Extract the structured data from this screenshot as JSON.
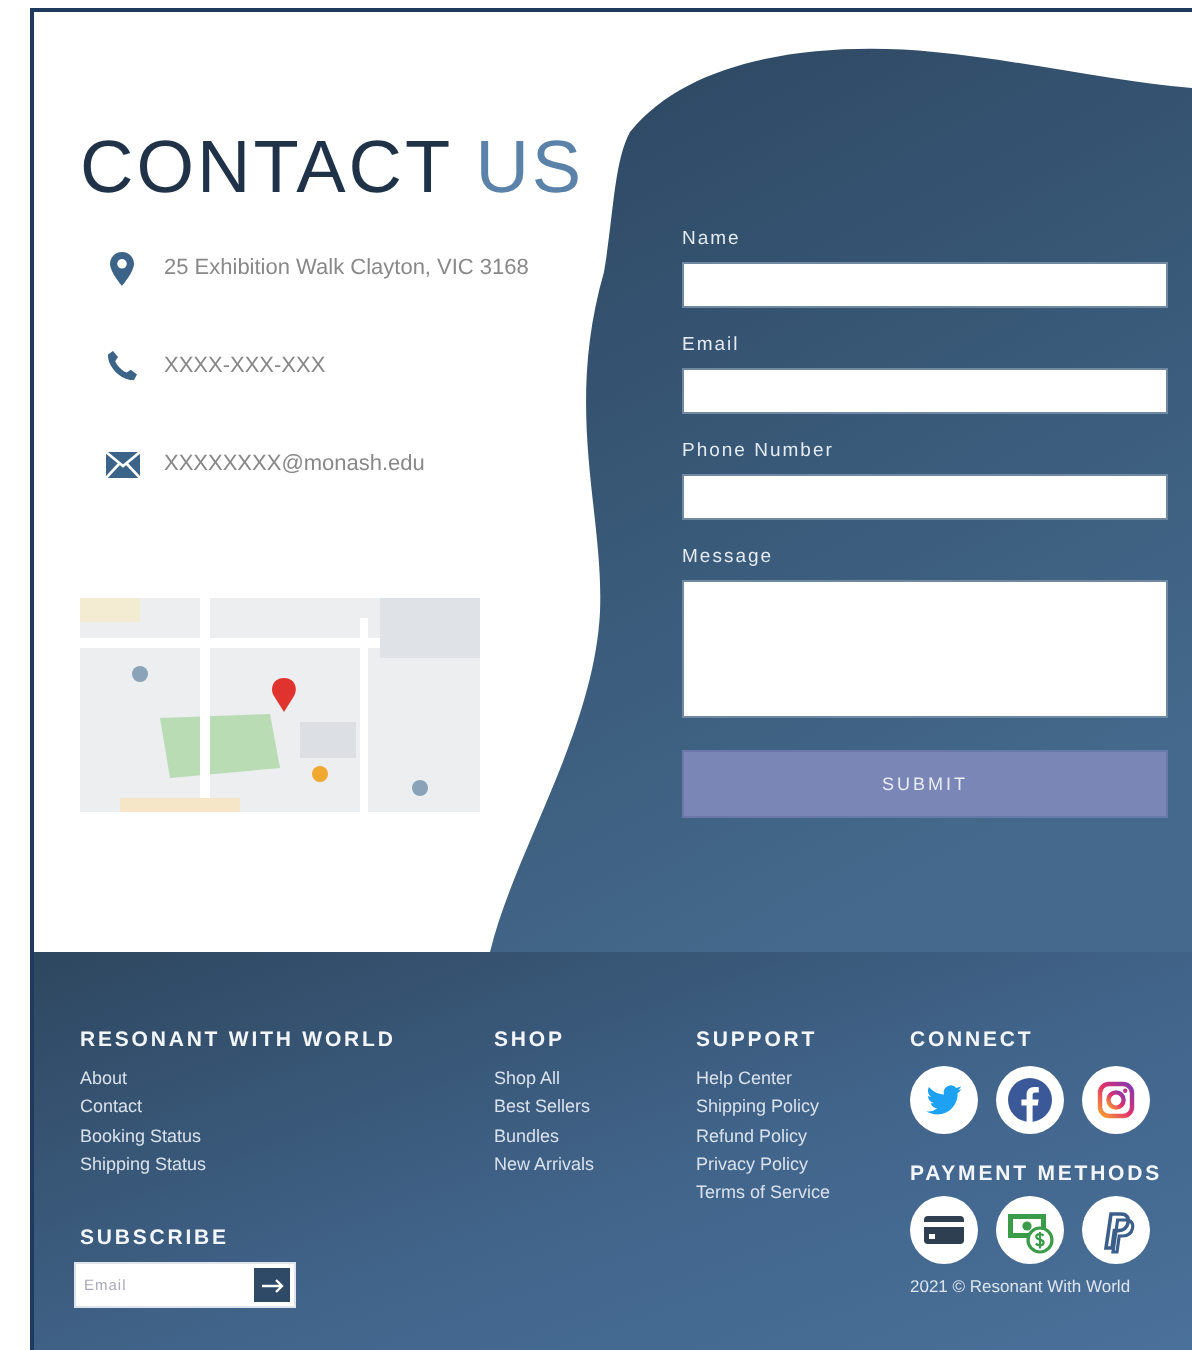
{
  "title": {
    "main": "CONTACT",
    "accent": "US"
  },
  "contacts": [
    {
      "kind": "location",
      "text": "25 Exhibition Walk Clayton, VIC 3168"
    },
    {
      "kind": "phone",
      "text": "XXXX-XXX-XXX"
    },
    {
      "kind": "email",
      "text": "XXXXXXXX@monash.edu"
    }
  ],
  "form": {
    "fields": [
      {
        "label": "Name",
        "kind": "line"
      },
      {
        "label": "Email",
        "kind": "line"
      },
      {
        "label": "Phone Number",
        "kind": "line"
      },
      {
        "label": "Message",
        "kind": "area"
      }
    ],
    "submit": "SUBMIT"
  },
  "footer": {
    "columns": [
      {
        "heading": "RESONANT WITH WORLD",
        "links": [
          "About",
          "Contact",
          "Booking Status",
          "Shipping Status"
        ]
      },
      {
        "heading": "SHOP",
        "links": [
          "Shop All",
          "Best Sellers",
          "Bundles",
          "New Arrivals"
        ]
      },
      {
        "heading": "SUPPORT",
        "links": [
          "Help Center",
          "Shipping Policy",
          "Refund Policy",
          "Privacy Policy",
          "Terms of Service"
        ]
      }
    ],
    "subscribe": {
      "heading": "SUBSCRIBE",
      "placeholder": "Email"
    },
    "connect": {
      "heading": "CONNECT"
    },
    "payment": {
      "heading": "PAYMENT METHODS"
    },
    "copyright": "2021 © Resonant With World"
  }
}
